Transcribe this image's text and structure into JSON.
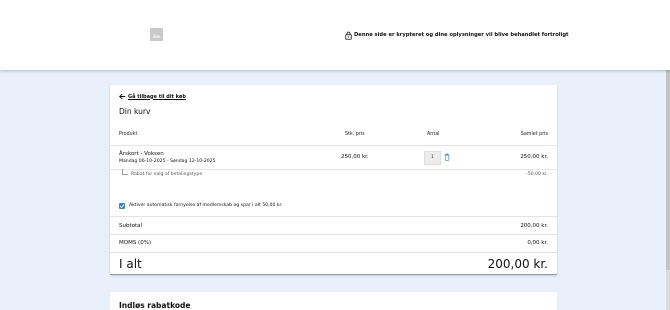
{
  "header": {
    "logo_icon": "image-placeholder-icon",
    "secure_icon": "lock-icon",
    "secure_text": "Denne side er krypteret og dine oplysninger vil blive behandlet fortroligt"
  },
  "cart": {
    "back_link": "Gå tilbage til dit køb",
    "back_icon": "arrow-left-icon",
    "title": "Din kurv",
    "columns": {
      "product": "Produkt",
      "unit_price": "Stk. pris",
      "quantity": "Antal",
      "total_price": "Samlet pris"
    },
    "items": [
      {
        "name": "Årskort - Voksen",
        "dates": "Mandag 06-10-2025 - Søndag 12-10-2025",
        "unit_price": "250,00 kr.",
        "quantity": "1",
        "total": "250,00 kr.",
        "discount_label": "Rabat for valg af betalingstype",
        "discount_value": "-50,00 kr."
      }
    ],
    "auto_renew": {
      "checked": true,
      "label": "Aktiver automatisk fornyelse af medlemskab og spar i alt 50,00 kr."
    },
    "subtotal_label": "Subtotal",
    "subtotal_value": "200,00 kr.",
    "vat_label": "MOMS (0%)",
    "vat_value": "0,00 kr.",
    "total_label": "I alt",
    "total_value": "200,00 kr."
  },
  "discount_code": {
    "title": "Indløs rabatkode"
  },
  "colors": {
    "page_background": "#e8f1fb",
    "accent": "#3b86c4"
  }
}
